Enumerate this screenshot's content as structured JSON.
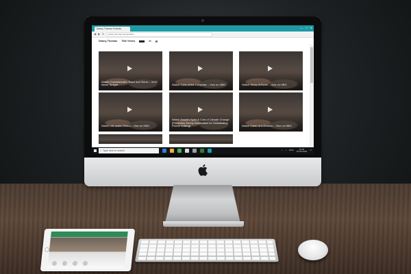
{
  "browser": {
    "tab_title": "Danny Thomas Portfolio",
    "url": "danny-thomas.com/portfolio",
    "window_controls": [
      "—",
      "□",
      "✕"
    ]
  },
  "site": {
    "name": "Danny Thomas",
    "nav": [
      "Title Vimeo",
      "",
      "in",
      ""
    ]
  },
  "videos": [
    {
      "caption": "Watch Charlottesville: Race and Terror – VICE News Tonight"
    },
    {
      "caption": "Watch Cubs of the Caliphate – Vice on HBO"
    },
    {
      "caption": "Watch Show of Force – Vice on HBO"
    },
    {
      "caption": "Watch Life under Shaka – Vice on HBO"
    },
    {
      "caption": "Watch Assad's Syria & Cost of Climate Change (Primetime Emmy Nomination for Outstanding Picture Editing)"
    },
    {
      "caption": "Watch Dawn of a Dictator – Vice on HBO"
    }
  ],
  "taskbar": {
    "search_placeholder": "Type here to search",
    "language": "ENG",
    "time": "10:26",
    "date": "15-05-2018"
  },
  "colors": {
    "browser_accent": "#1e9aa5",
    "taskbar": "#101417"
  }
}
